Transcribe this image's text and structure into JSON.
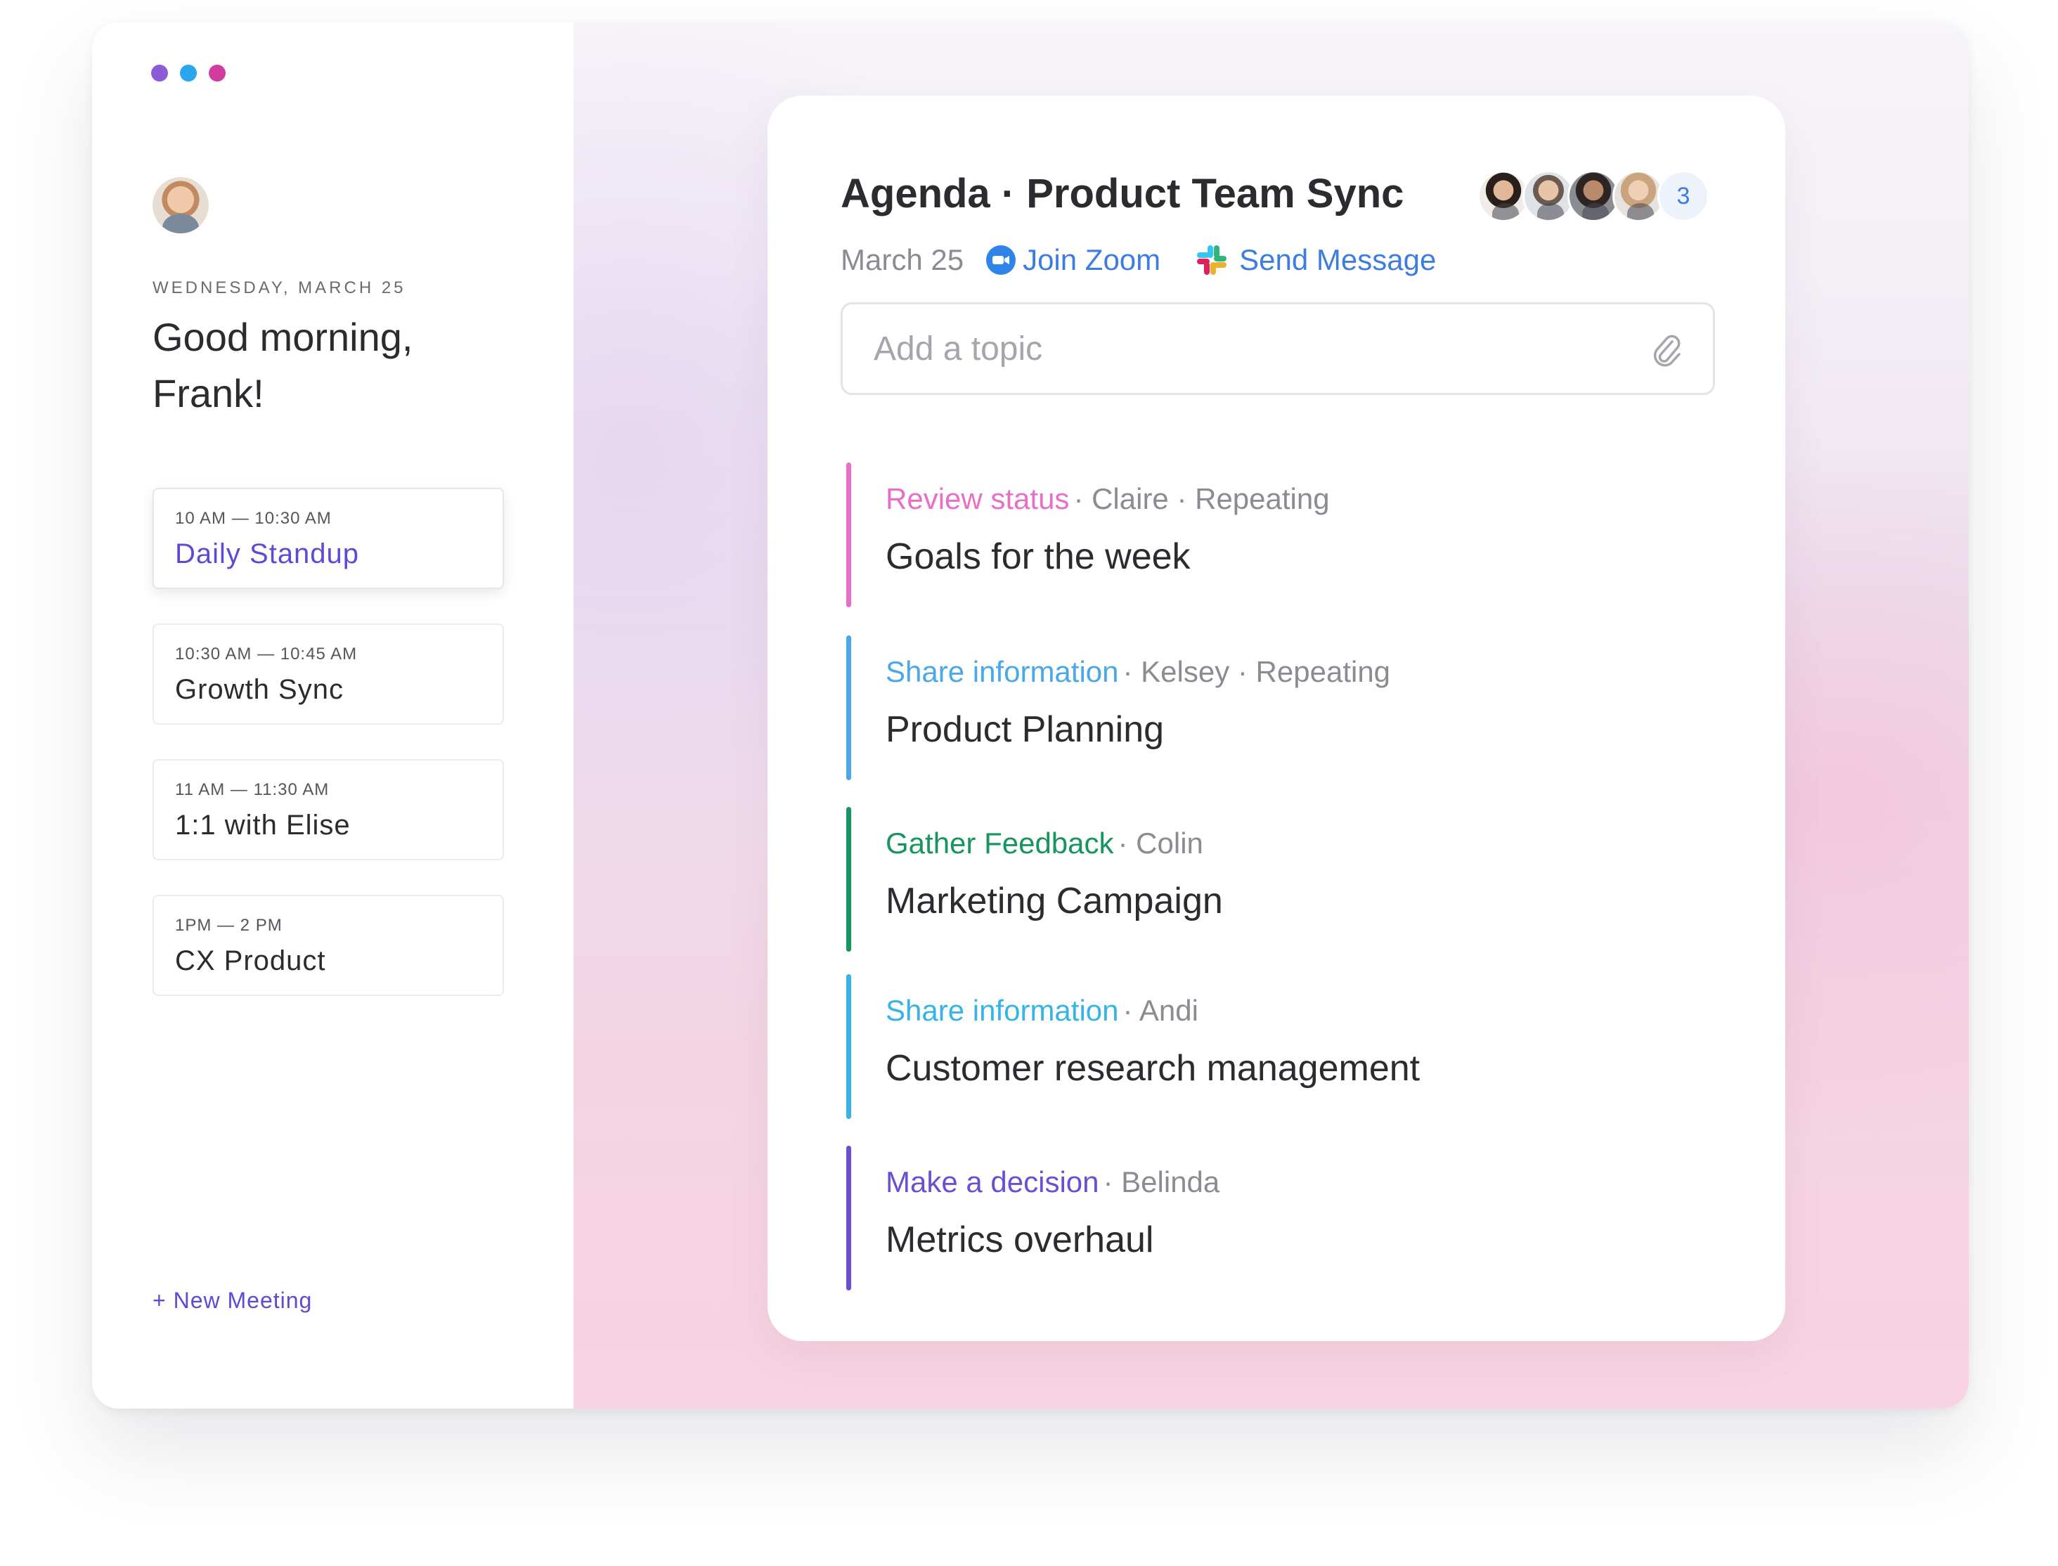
{
  "window": {
    "traffic_colors": [
      "#8e5bd8",
      "#2aa5ee",
      "#d23ba0"
    ]
  },
  "sidebar": {
    "date": "WEDNESDAY, MARCH 25",
    "greeting": "Good morning, Frank!",
    "meetings": [
      {
        "time": "10 AM — 10:30 AM",
        "title": "Daily Standup",
        "active": true
      },
      {
        "time": "10:30 AM — 10:45 AM",
        "title": "Growth Sync",
        "active": false
      },
      {
        "time": "11 AM — 11:30 AM",
        "title": "1:1 with Elise",
        "active": false
      },
      {
        "time": "1PM — 2 PM",
        "title": "CX Product",
        "active": false
      }
    ],
    "new_meeting": "+ New Meeting"
  },
  "agenda": {
    "title": "Agenda · Product Team Sync",
    "date": "March 25",
    "join_zoom": "Join Zoom",
    "send_message": "Send Message",
    "attendee_overflow": "3",
    "topic_placeholder": "Add a topic",
    "items": [
      {
        "kind": "Review status",
        "details": "· Claire · Repeating",
        "topic": "Goals for the week",
        "color": "#e86fc8"
      },
      {
        "kind": "Share information",
        "details": "· Kelsey · Repeating",
        "topic": "Product Planning",
        "color": "#4aa8e8"
      },
      {
        "kind": "Gather Feedback",
        "details": "· Colin",
        "topic": "Marketing Campaign",
        "color": "#17955f"
      },
      {
        "kind": "Share information",
        "details": "· Andi",
        "topic": "Customer research management",
        "color": "#37b3e6"
      },
      {
        "kind": "Make a decision",
        "details": "· Belinda",
        "topic": "Metrics overhaul",
        "color": "#6a4fd2"
      }
    ]
  },
  "colors": {
    "accent": "#5b4bd6",
    "link": "#3d7de0"
  }
}
